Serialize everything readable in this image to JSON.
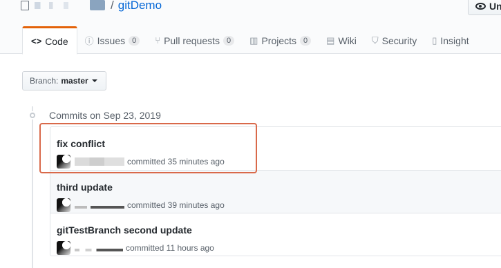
{
  "repo": {
    "separator": "/",
    "name": "gitDemo"
  },
  "watch_button": {
    "label": "Un",
    "icon": "eye-icon"
  },
  "tabs": [
    {
      "label": "Code",
      "icon": "code-icon",
      "selected": true
    },
    {
      "label": "Issues",
      "icon": "issue-opened-icon",
      "count": "0"
    },
    {
      "label": "Pull requests",
      "icon": "git-pull-request-icon",
      "count": "0"
    },
    {
      "label": "Projects",
      "icon": "project-icon",
      "count": "0"
    },
    {
      "label": "Wiki",
      "icon": "book-icon"
    },
    {
      "label": "Security",
      "icon": "shield-icon"
    },
    {
      "label": "Insight",
      "icon": "graph-icon"
    }
  ],
  "branch": {
    "label": "Branch:",
    "value": "master"
  },
  "commit_group": {
    "title": "Commits on Sep 23, 2019"
  },
  "commits": [
    {
      "message": "fix conflict",
      "time": "committed 35 minutes ago"
    },
    {
      "message": "third update",
      "time": "committed 39 minutes ago"
    },
    {
      "message": "gitTestBranch second update",
      "time": "committed 11 hours ago"
    }
  ],
  "colors": {
    "link": "#0366d6",
    "selected_tab_accent": "#e36209",
    "highlight_box": "#d9694a"
  }
}
